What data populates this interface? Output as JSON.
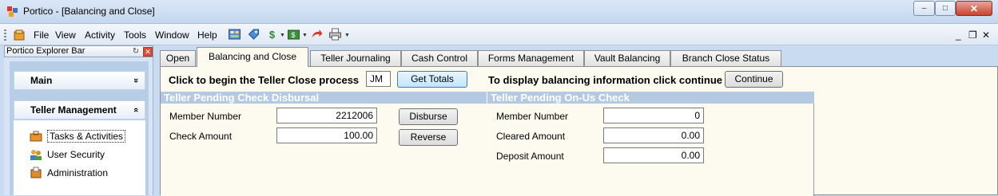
{
  "window": {
    "title": "Portico - [Balancing and Close]",
    "minimize_glyph": "–",
    "maximize_glyph": "□",
    "close_glyph": "✕"
  },
  "menu": {
    "items": [
      "File",
      "View",
      "Activity",
      "Tools",
      "Window",
      "Help"
    ],
    "mdi_controls": [
      "_",
      "❐",
      "✕"
    ]
  },
  "toolbar": {
    "icons": [
      "calculator-icon",
      "tag-icon",
      "money-icon",
      "cash-drawer-icon",
      "undo-arrow-icon",
      "printer-icon"
    ]
  },
  "explorer": {
    "title": "Portico Explorer Bar",
    "pin_glyph": "↻",
    "close_glyph": "✕",
    "groups": [
      {
        "label": "Main",
        "chevron": "»"
      },
      {
        "label": "Teller Management",
        "chevron": "«"
      }
    ],
    "items": [
      {
        "label": "Tasks & Activities",
        "selected": true
      },
      {
        "label": "User Security",
        "selected": false
      },
      {
        "label": "Administration",
        "selected": false
      }
    ]
  },
  "tabs": [
    {
      "label": "Open"
    },
    {
      "label": "Balancing and Close",
      "active": true
    },
    {
      "label": "Teller Journaling"
    },
    {
      "label": "Cash Control"
    },
    {
      "label": "Forms Management"
    },
    {
      "label": "Vault Balancing"
    },
    {
      "label": "Branch Close Status"
    }
  ],
  "close_process": {
    "prompt": "Click to begin the Teller Close process",
    "teller_initials": "JM",
    "get_totals_label": "Get Totals",
    "continue_prompt": "To display balancing information click continue",
    "continue_label": "Continue"
  },
  "check_disbursal": {
    "title": "Teller Pending Check Disbursal",
    "member_number_label": "Member Number",
    "member_number": "2212006",
    "check_amount_label": "Check Amount",
    "check_amount": "100.00",
    "disburse_label": "Disburse",
    "reverse_label": "Reverse"
  },
  "onus_check": {
    "title": "Teller Pending On-Us Check",
    "member_number_label": "Member Number",
    "member_number": "0",
    "cleared_amount_label": "Cleared Amount",
    "cleared_amount": "0.00",
    "deposit_amount_label": "Deposit Amount",
    "deposit_amount": "0.00"
  }
}
